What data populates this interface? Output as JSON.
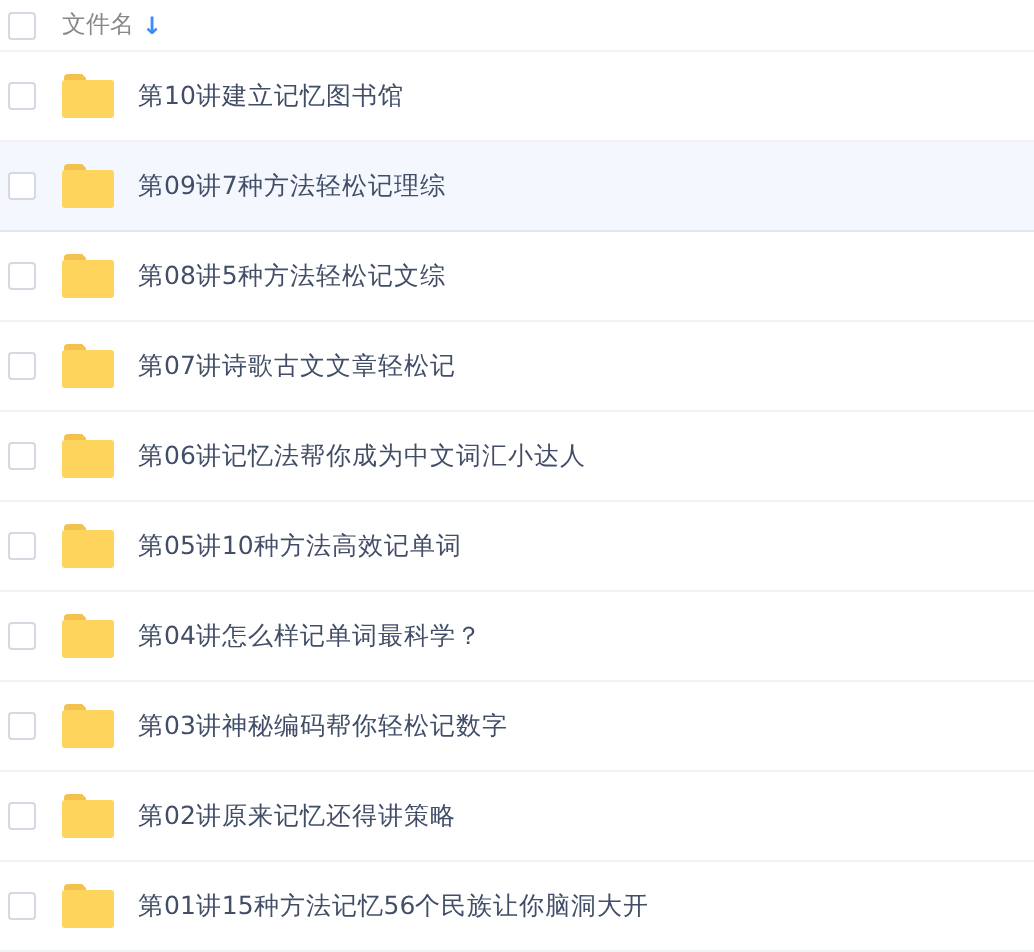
{
  "header": {
    "column_label": "文件名",
    "sort_icon": "↓",
    "checked": false
  },
  "rows": [
    {
      "name": "第10讲建立记忆图书馆",
      "checked": false,
      "hovered": false
    },
    {
      "name": "第09讲7种方法轻松记理综",
      "checked": false,
      "hovered": true
    },
    {
      "name": "第08讲5种方法轻松记文综",
      "checked": false,
      "hovered": false
    },
    {
      "name": "第07讲诗歌古文文章轻松记",
      "checked": false,
      "hovered": false
    },
    {
      "name": "第06讲记忆法帮你成为中文词汇小达人",
      "checked": false,
      "hovered": false
    },
    {
      "name": "第05讲10种方法高效记单词",
      "checked": false,
      "hovered": false
    },
    {
      "name": "第04讲怎么样记单词最科学？",
      "checked": false,
      "hovered": false
    },
    {
      "name": "第03讲神秘编码帮你轻松记数字",
      "checked": false,
      "hovered": false
    },
    {
      "name": "第02讲原来记忆还得讲策略",
      "checked": false,
      "hovered": false
    },
    {
      "name": "第01讲15种方法记忆56个民族让你脑洞大开",
      "checked": false,
      "hovered": false
    }
  ]
}
